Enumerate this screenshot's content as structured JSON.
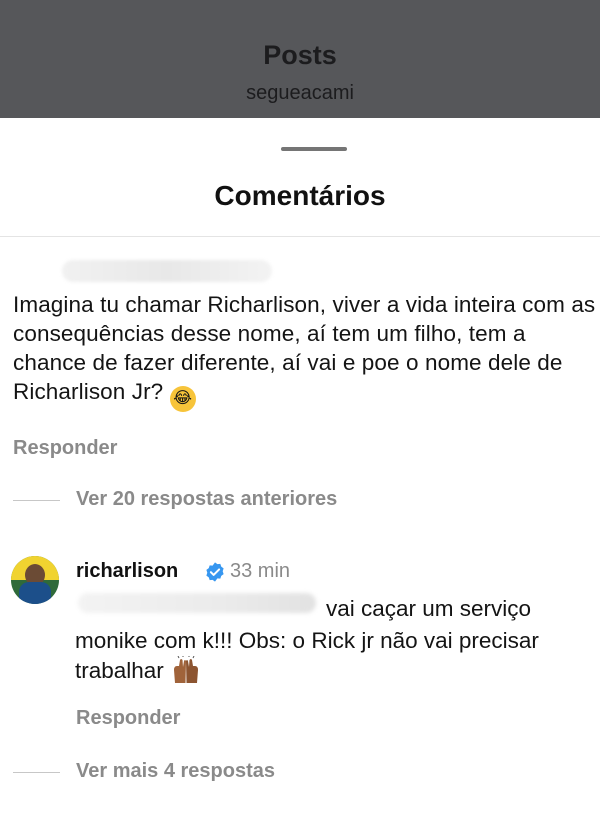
{
  "header": {
    "title": "Posts",
    "subtitle": "segueacami"
  },
  "sheet": {
    "title": "Comentários"
  },
  "comment": {
    "text": "Imagina tu chamar Richarlison, viver a vida inteira com as consequências desse nome, aí tem um filho, tem a chance de fazer diferente, aí vai e poe o nome dele de Richarlison Jr?",
    "emoji": "😂",
    "reply_label": "Responder",
    "view_previous_label": "Ver 20 respostas anteriores"
  },
  "reply": {
    "username": "richarlison",
    "time": "33 min",
    "text_first": "vai caçar um serviço",
    "text_rest": "monike com k!!! Obs: o Rick jr não vai precisar trabalhar",
    "reply_label": "Responder",
    "view_more_label": "Ver mais 4 respostas"
  },
  "colors": {
    "verified": "#3797f0",
    "muted": "#8a8a8a",
    "overlay": "#56575a"
  }
}
